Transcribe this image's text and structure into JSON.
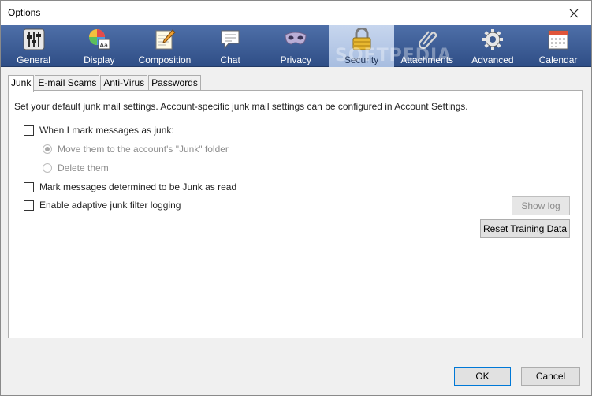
{
  "window": {
    "title": "Options"
  },
  "toolbar": {
    "panes": [
      {
        "label": "General",
        "icon": "sliders-icon"
      },
      {
        "label": "Display",
        "icon": "color-wheel-icon"
      },
      {
        "label": "Composition",
        "icon": "notepad-pen-icon"
      },
      {
        "label": "Chat",
        "icon": "speech-bubble-icon"
      },
      {
        "label": "Privacy",
        "icon": "mask-icon"
      },
      {
        "label": "Security",
        "icon": "padlock-icon",
        "selected": true
      },
      {
        "label": "Attachments",
        "icon": "paperclip-icon"
      },
      {
        "label": "Advanced",
        "icon": "gear-icon"
      },
      {
        "label": "Calendar",
        "icon": "calendar-icon"
      }
    ],
    "selected_color": "#b6c9e8"
  },
  "watermark": "SOFTPEDIA",
  "subtabs": [
    {
      "label": "Junk",
      "active": true
    },
    {
      "label": "E-mail Scams"
    },
    {
      "label": "Anti-Virus"
    },
    {
      "label": "Passwords"
    }
  ],
  "junk": {
    "description": "Set your default junk mail settings. Account-specific junk mail settings can be configured in Account Settings.",
    "mark_as_junk_label": "When I mark messages as junk:",
    "mark_as_junk_checked": false,
    "move_option_label": "Move them to the account's \"Junk\" folder",
    "move_option_selected": true,
    "delete_option_label": "Delete them",
    "mark_read_label": "Mark messages determined to be Junk as read",
    "mark_read_checked": false,
    "logging_label": "Enable adaptive junk filter logging",
    "logging_checked": false,
    "show_log_label": "Show log",
    "reset_training_label": "Reset Training Data"
  },
  "footer": {
    "ok_label": "OK",
    "cancel_label": "Cancel"
  }
}
